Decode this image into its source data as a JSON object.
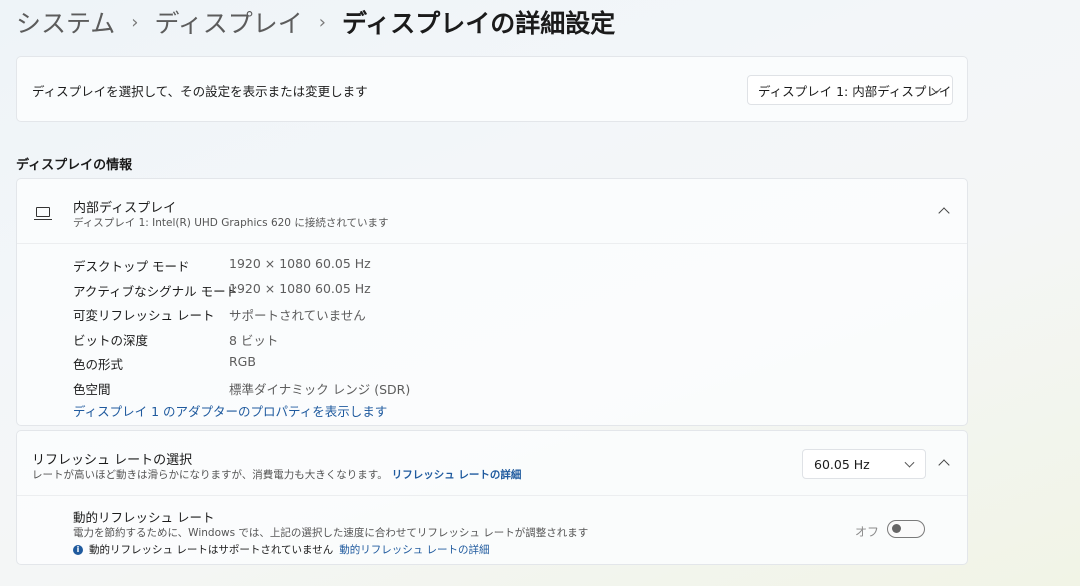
{
  "breadcrumb": {
    "items": [
      "システム",
      "ディスプレイ"
    ],
    "separator": "›",
    "current": "ディスプレイの詳細設定"
  },
  "display_select": {
    "label": "ディスプレイを選択して、その設定を表示または変更します",
    "selected": "ディスプレイ 1: 内部ディスプレイ"
  },
  "display_info": {
    "section_title": "ディスプレイの情報",
    "name": "内部ディスプレイ",
    "subtitle": "ディスプレイ 1: Intel(R) UHD Graphics 620 に接続されています",
    "rows": [
      {
        "key": "デスクトップ モード",
        "value": "1920 × 1080 60.05 Hz"
      },
      {
        "key": "アクティブなシグナル モード",
        "value": "1920 × 1080 60.05 Hz"
      },
      {
        "key": "可変リフレッシュ レート",
        "value": "サポートされていません"
      },
      {
        "key": "ビットの深度",
        "value": "8 ビット"
      },
      {
        "key": "色の形式",
        "value": "RGB"
      },
      {
        "key": "色空間",
        "value": "標準ダイナミック レンジ (SDR)"
      }
    ],
    "adapter_link": "ディスプレイ 1 のアダプターのプロパティを表示します"
  },
  "refresh": {
    "title": "リフレッシュ レートの選択",
    "subtitle": "レートが高いほど動きは滑らかになりますが、消費電力も大きくなります。",
    "details_link": "リフレッシュ レートの詳細",
    "selected": "60.05 Hz",
    "dynamic": {
      "title": "動的リフレッシュ レート",
      "subtitle": "電力を節約するために、Windows では、上記の選択した速度に合わせてリフレッシュ レートが調整されます",
      "note": "動的リフレッシュ レートはサポートされていません",
      "note_link": "動的リフレッシュ レートの詳細",
      "toggle_label": "オフ",
      "toggle_on": false
    }
  },
  "colors": {
    "accent": "#1f5a9e"
  }
}
